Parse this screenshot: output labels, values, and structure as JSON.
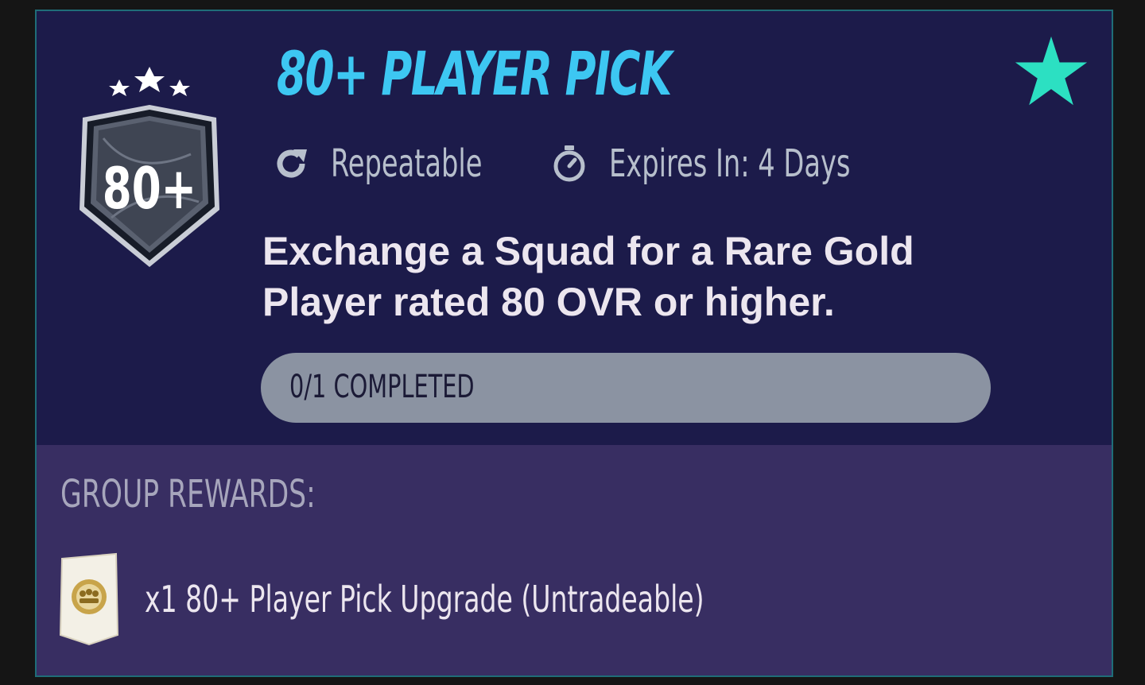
{
  "challenge": {
    "title": "80+ PLAYER PICK",
    "badge_text": "80+",
    "badge_stars": 3,
    "favorite_icon": "star-icon",
    "repeat": {
      "icon": "repeat-icon",
      "label": "Repeatable"
    },
    "expiry": {
      "icon": "stopwatch-icon",
      "label": "Expires In: 4 Days"
    },
    "description": "Exchange a Squad for a Rare Gold Player rated 80 OVR or higher.",
    "progress": {
      "label": "0/1 COMPLETED",
      "completed": 0,
      "total": 1
    }
  },
  "rewards": {
    "label": "GROUP REWARDS:",
    "items": [
      {
        "icon": "pack-icon",
        "text": "x1 80+ Player Pick Upgrade (Untradeable)"
      }
    ]
  },
  "colors": {
    "accent": "#3dc7f2",
    "star": "#2ce0c2",
    "top_bg": "#1c1b4a",
    "bottom_bg": "#382e62",
    "progress_bg": "#8b93a2"
  }
}
